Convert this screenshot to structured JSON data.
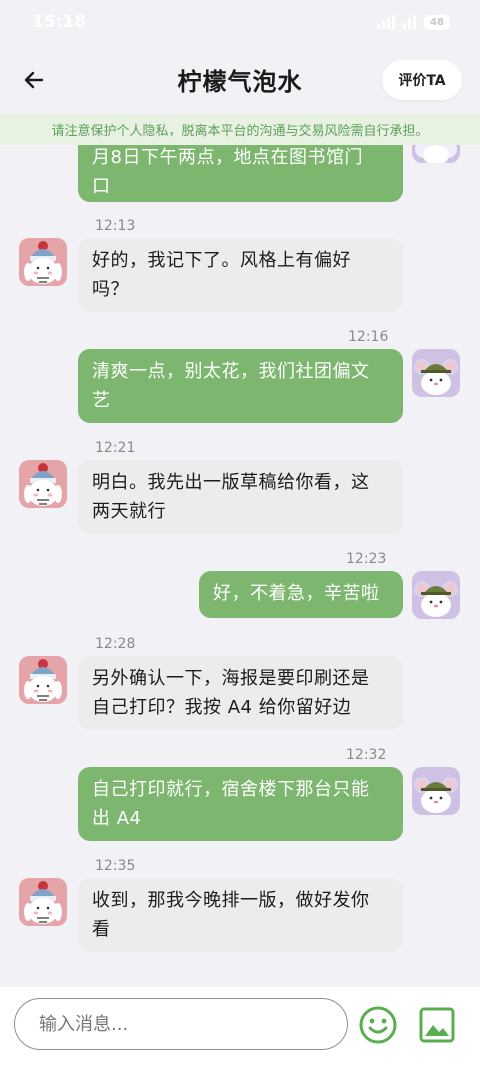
{
  "status_bar": {
    "time": "15:18",
    "battery": "48"
  },
  "header": {
    "title": "柠檬气泡水",
    "rate_button": "评价TA"
  },
  "notice": "请注意保护个人隐私，脱离本平台的沟通与交易风险需自行承担。",
  "messages": [
    {
      "sender": "me",
      "time": "",
      "lines": [
        "月8日下午两点，地点在图书馆门",
        "口"
      ]
    },
    {
      "sender": "them",
      "time": "12:13",
      "lines": [
        "好的，我记下了。风格上有偏好",
        "吗？"
      ]
    },
    {
      "sender": "me",
      "time": "12:16",
      "lines": [
        "清爽一点，别太花，我们社团偏文",
        "艺"
      ]
    },
    {
      "sender": "them",
      "time": "12:21",
      "lines": [
        "明白。我先出一版草稿给你看，这",
        "两天就行"
      ]
    },
    {
      "sender": "me",
      "time": "12:23",
      "lines": [
        "好，不着急，辛苦啦"
      ]
    },
    {
      "sender": "them",
      "time": "12:28",
      "lines": [
        "另外确认一下，海报是要印刷还是",
        "自己打印？我按 A4 给你留好边"
      ]
    },
    {
      "sender": "me",
      "time": "12:32",
      "lines": [
        "自己打印就行，宿舍楼下那台只能",
        "出 A4"
      ]
    },
    {
      "sender": "them",
      "time": "12:35",
      "lines": [
        "收到，那我今晚排一版，做好发你",
        "看"
      ]
    }
  ],
  "input": {
    "placeholder": "输入消息..."
  },
  "icons": {
    "back": "back-arrow-icon",
    "emoji": "emoji-icon",
    "image": "image-icon"
  },
  "colors": {
    "my_bubble": "#7cb66f",
    "their_bubble": "#ececec",
    "notice_bg": "#e7f2e3",
    "notice_text": "#5d9f58",
    "accent": "#5aae4f"
  }
}
